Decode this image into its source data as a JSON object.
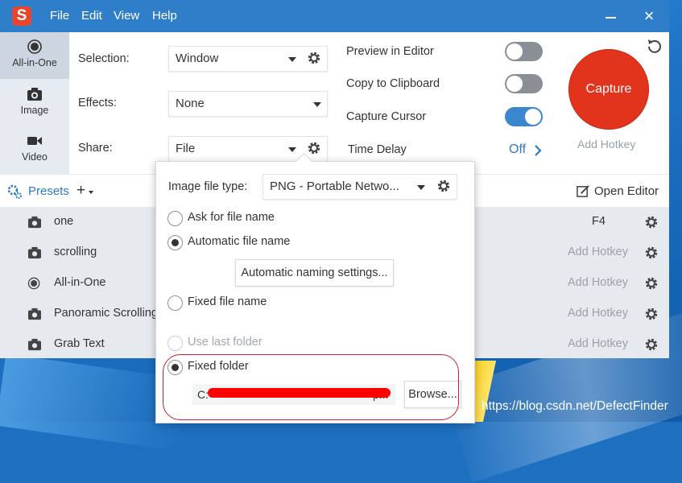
{
  "menu": {
    "file": "File",
    "edit": "Edit",
    "view": "View",
    "help": "Help"
  },
  "app": {
    "logo_letter": "S",
    "logo_icon": "snagit-logo-icon",
    "close": "×"
  },
  "tabs": [
    {
      "label": "All-in-One",
      "icon": "all-in-one-icon"
    },
    {
      "label": "Image",
      "icon": "camera-icon"
    },
    {
      "label": "Video",
      "icon": "video-camera-icon"
    }
  ],
  "settings": {
    "selection_label": "Selection:",
    "selection_value": "Window",
    "effects_label": "Effects:",
    "effects_value": "None",
    "share_label": "Share:",
    "share_value": "File"
  },
  "options": {
    "preview_label": "Preview in Editor",
    "clipboard_label": "Copy to Clipboard",
    "cursor_label": "Capture Cursor",
    "time_delay_label": "Time Delay",
    "time_delay_value": "Off"
  },
  "capture": {
    "label": "Capture",
    "hotkey": "Add Hotkey"
  },
  "presets": {
    "label": "Presets",
    "add": "+",
    "open_editor": "Open Editor",
    "items": [
      {
        "name": "one",
        "hotkey": "F4",
        "icon": "camera-icon"
      },
      {
        "name": "scrolling",
        "hotkey": "Add Hotkey",
        "icon": "camera-icon"
      },
      {
        "name": "All-in-One",
        "hotkey": "Add Hotkey",
        "icon": "all-in-one-icon"
      },
      {
        "name": "Panoramic Scrolling",
        "hotkey": "Add Hotkey",
        "icon": "camera-icon"
      },
      {
        "name": "Grab Text",
        "hotkey": "Add Hotkey",
        "icon": "camera-icon"
      }
    ]
  },
  "popup": {
    "file_type_label": "Image file type:",
    "file_type_value": "PNG - Portable Netwo...",
    "ask_name": "Ask for file name",
    "auto_name": "Automatic file name",
    "naming_settings": "Automatic naming settings...",
    "fixed_name": "Fixed file name",
    "use_last_folder": "Use last folder",
    "fixed_folder": "Fixed folder",
    "folder_path_prefix": "C:",
    "folder_path_suffix": "p...",
    "browse": "Browse..."
  },
  "watermark": "https://blog.csdn.net/DefectFinder",
  "colors": {
    "titlebar": "#2f7ec9",
    "capture": "#e2341c",
    "toggle_on": "#3a86cf",
    "accent_link": "#2b7bc7"
  }
}
